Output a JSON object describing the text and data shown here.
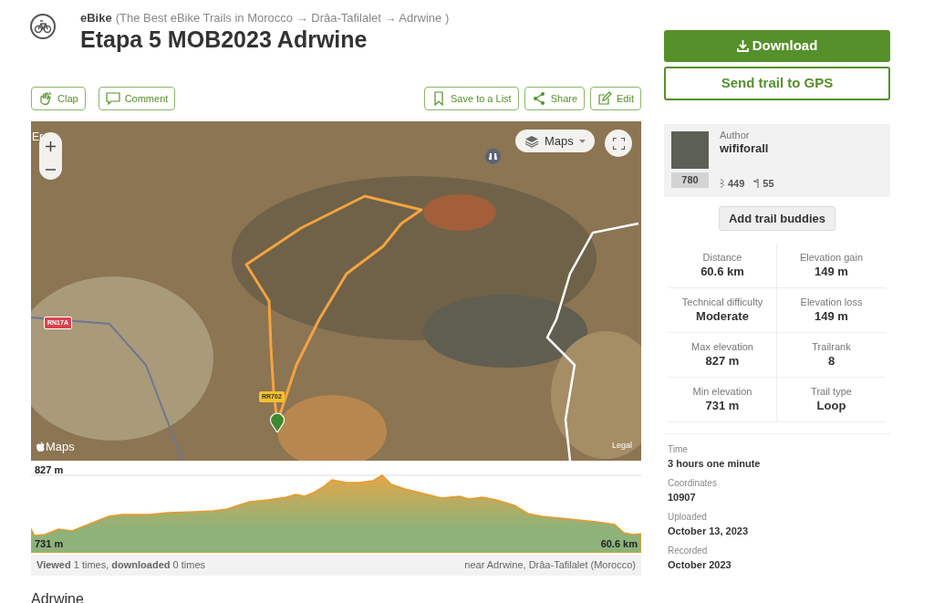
{
  "header": {
    "sport": "eBike",
    "breadcrumb": "(The Best eBike Trails in Morocco → Drâa-Tafilalet → Adrwine )",
    "title": "Etapa 5 MOB2023 Adrwine"
  },
  "actions_left": [
    {
      "kind": "clap",
      "label": "Clap"
    },
    {
      "kind": "comment",
      "label": "Comment"
    }
  ],
  "actions_right": [
    {
      "kind": "bookmark",
      "label": "Save to a List"
    },
    {
      "kind": "share",
      "label": "Share"
    },
    {
      "kind": "edit",
      "label": "Edit"
    }
  ],
  "map": {
    "place_label": "Er",
    "layer_button": "Maps",
    "road_labels": [
      {
        "kind": "national",
        "label": "RN17A"
      },
      {
        "kind": "regional",
        "label": "RR702"
      }
    ],
    "logo": "Maps",
    "legal": "Legal"
  },
  "elevation": {
    "max": "827 m",
    "min": "731 m",
    "distance": "60.6 km"
  },
  "footer": {
    "views": "**Viewed** 1 times, **downloaded** 0 times",
    "location": "near Adrwine, Drâa-Tafilalet (Morocco)"
  },
  "section_heading": "Adrwine",
  "download_button": "Download",
  "gps_button": "Send trail to GPS",
  "author": {
    "label": "Author",
    "name": "wififorall",
    "rank": "780",
    "followers": "449",
    "trails": "55"
  },
  "buddies_button": "Add trail buddies",
  "stats": [
    {
      "label": "Distance",
      "value": "60.6 km"
    },
    {
      "label": "Elevation gain",
      "value": "149 m"
    },
    {
      "label": "Technical difficulty",
      "value": "Moderate"
    },
    {
      "label": "Elevation loss",
      "value": "149 m"
    },
    {
      "label": "Max elevation",
      "value": "827 m"
    },
    {
      "label": "Trailrank",
      "value": "8"
    },
    {
      "label": "Min elevation",
      "value": "731 m"
    },
    {
      "label": "Trail type",
      "value": "Loop"
    }
  ],
  "details": [
    {
      "label": "Time",
      "value": "3 hours one minute"
    },
    {
      "label": "Coordinates",
      "value": "10907"
    },
    {
      "label": "Uploaded",
      "value": "October 13, 2023"
    },
    {
      "label": "Recorded",
      "value": "October 2023"
    }
  ]
}
